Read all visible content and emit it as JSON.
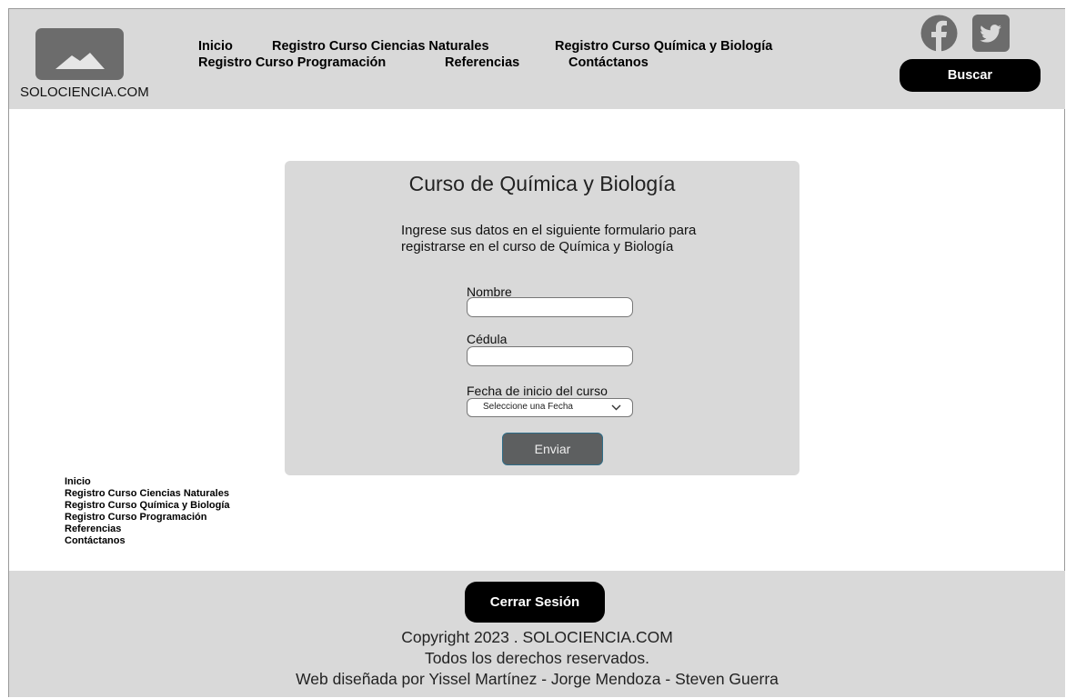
{
  "header": {
    "site_name": "SOLOCIENCIA.COM",
    "nav": [
      "Inicio",
      "Registro Curso Ciencias Naturales",
      "Registro Curso Química y Biología",
      "Registro Curso Programación",
      "Referencias",
      "Contáctanos"
    ],
    "search_label": "Buscar",
    "social": [
      "facebook-icon",
      "twitter-icon"
    ]
  },
  "form": {
    "title": "Curso de Química y Biología",
    "description": "Ingrese sus datos en el siguiente formulario para registrarse en el curso de Química y Biología",
    "fields": {
      "nombre_label": "Nombre",
      "nombre_value": "",
      "cedula_label": "Cédula",
      "cedula_value": "",
      "fecha_label": "Fecha de inicio del curso",
      "fecha_selected": "Seleccione una Fecha"
    },
    "submit_label": "Enviar"
  },
  "side_nav": [
    "Inicio",
    "Registro Curso Ciencias Naturales",
    "Registro Curso Química y Biología",
    "Registro Curso Programación",
    "Referencias",
    "Contáctanos"
  ],
  "footer": {
    "logout_label": "Cerrar Sesión",
    "copyright": "Copyright 2023 . SOLOCIENCIA.COM",
    "rights": "Todos los derechos reservados.",
    "credits": "Web diseñada por Yissel Martínez - Jorge Mendoza - Steven Guerra"
  },
  "colors": {
    "panel_gray": "#d9d9d9",
    "button_black": "#000000",
    "submit_gray": "#5d5f60",
    "logo_gray": "#6c6c6c"
  }
}
